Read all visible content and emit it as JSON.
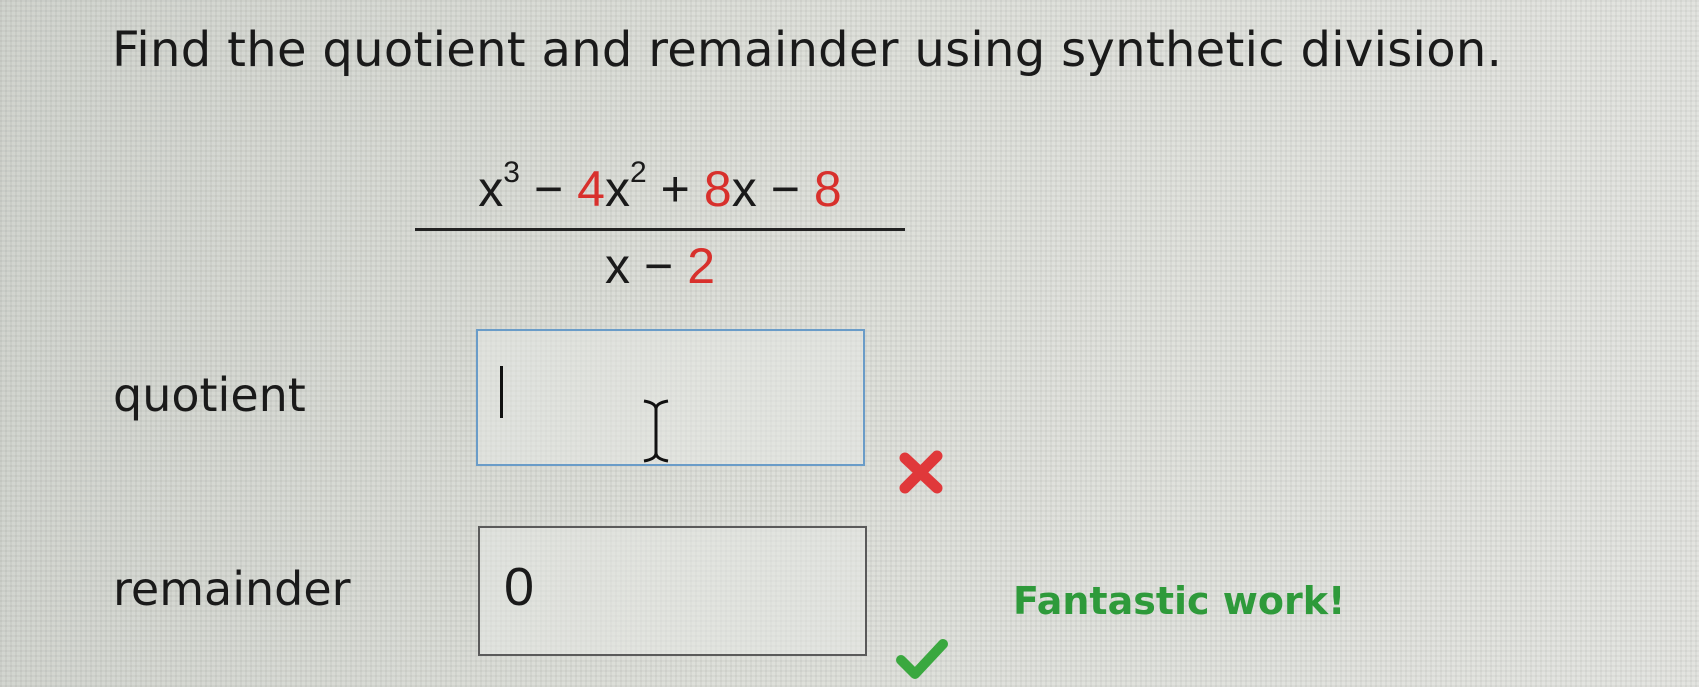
{
  "question": {
    "prompt": "Find the quotient and remainder using synthetic division."
  },
  "expression": {
    "numerator": {
      "term1_base": "x",
      "term1_exp": "3",
      "op1": "−",
      "term2_coef": "4",
      "term2_base": "x",
      "term2_exp": "2",
      "op2": "+",
      "term3_coef": "8",
      "term3_base": "x",
      "op3": "−",
      "term4": "8"
    },
    "denominator": {
      "base": "x",
      "op": "−",
      "const": "2"
    }
  },
  "quotient": {
    "label": "quotient",
    "value": "",
    "status": "incorrect",
    "status_icon": "x-mark-icon",
    "status_color": "#e0383a"
  },
  "remainder": {
    "label": "remainder",
    "value": "0",
    "status": "correct",
    "status_icon": "check-mark-icon",
    "status_color": "#3aa83f",
    "feedback": "Fantastic work!"
  },
  "colors": {
    "highlight_red": "#d8302c",
    "feedback_green": "#2e9a3a",
    "focus_border": "#6a9cc8"
  }
}
